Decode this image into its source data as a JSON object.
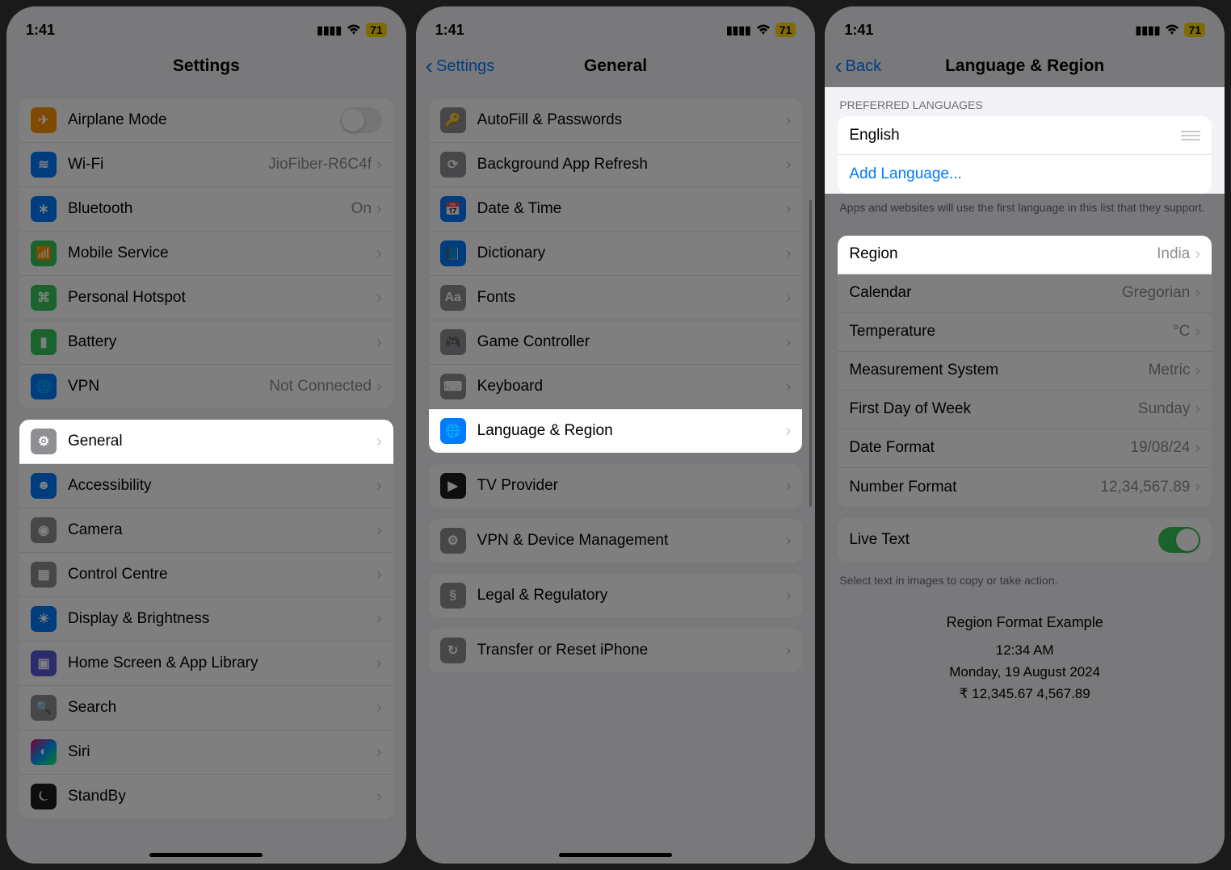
{
  "status": {
    "time": "1:41",
    "battery": "71"
  },
  "phone1": {
    "title": "Settings",
    "group1": [
      {
        "icon": "airplane",
        "label": "Airplane Mode",
        "toggle": false
      },
      {
        "icon": "wifi",
        "label": "Wi-Fi",
        "value": "JioFiber-R6C4f"
      },
      {
        "icon": "bluetooth",
        "label": "Bluetooth",
        "value": "On"
      },
      {
        "icon": "mobile",
        "label": "Mobile Service",
        "value": ""
      },
      {
        "icon": "hotspot",
        "label": "Personal Hotspot",
        "value": ""
      },
      {
        "icon": "battery",
        "label": "Battery",
        "value": ""
      },
      {
        "icon": "vpn",
        "label": "VPN",
        "value": "Not Connected"
      }
    ],
    "group2": [
      {
        "icon": "general",
        "label": "General"
      },
      {
        "icon": "accessibility",
        "label": "Accessibility"
      },
      {
        "icon": "camera",
        "label": "Camera"
      },
      {
        "icon": "control",
        "label": "Control Centre"
      },
      {
        "icon": "display",
        "label": "Display & Brightness"
      },
      {
        "icon": "home",
        "label": "Home Screen & App Library"
      },
      {
        "icon": "search",
        "label": "Search"
      },
      {
        "icon": "siri",
        "label": "Siri"
      },
      {
        "icon": "standby",
        "label": "StandBy"
      }
    ]
  },
  "phone2": {
    "back": "Settings",
    "title": "General",
    "group1": [
      {
        "icon": "autofill",
        "label": "AutoFill & Passwords"
      },
      {
        "icon": "refresh",
        "label": "Background App Refresh"
      },
      {
        "icon": "date",
        "label": "Date & Time"
      },
      {
        "icon": "dictionary",
        "label": "Dictionary"
      },
      {
        "icon": "fonts",
        "label": "Fonts"
      },
      {
        "icon": "game",
        "label": "Game Controller"
      },
      {
        "icon": "keyboard",
        "label": "Keyboard"
      },
      {
        "icon": "language",
        "label": "Language & Region"
      }
    ],
    "group2": [
      {
        "icon": "tv",
        "label": "TV Provider"
      }
    ],
    "group3": [
      {
        "icon": "vpnmgmt",
        "label": "VPN & Device Management"
      }
    ],
    "group4": [
      {
        "icon": "legal",
        "label": "Legal & Regulatory"
      }
    ],
    "group5": [
      {
        "icon": "transfer",
        "label": "Transfer or Reset iPhone"
      }
    ]
  },
  "phone3": {
    "back": "Back",
    "title": "Language & Region",
    "pref_header": "PREFERRED LANGUAGES",
    "language": "English",
    "add_language": "Add Language...",
    "pref_footer": "Apps and websites will use the first language in this list that they support.",
    "region_row": {
      "label": "Region",
      "value": "India"
    },
    "rows": [
      {
        "label": "Calendar",
        "value": "Gregorian"
      },
      {
        "label": "Temperature",
        "value": "°C"
      },
      {
        "label": "Measurement System",
        "value": "Metric"
      },
      {
        "label": "First Day of Week",
        "value": "Sunday"
      },
      {
        "label": "Date Format",
        "value": "19/08/24"
      },
      {
        "label": "Number Format",
        "value": "12,34,567.89"
      }
    ],
    "live_text": "Live Text",
    "live_text_footer": "Select text in images to copy or take action.",
    "example": {
      "title": "Region Format Example",
      "time": "12:34 AM",
      "date": "Monday, 19 August 2024",
      "numbers": "₹ 12,345.67   4,567.89"
    }
  },
  "iconColors": {
    "airplane": "#ff9500",
    "wifi": "#007aff",
    "bluetooth": "#007aff",
    "mobile": "#34c759",
    "hotspot": "#34c759",
    "battery": "#34c759",
    "vpn": "#007aff",
    "general": "#8e8e93",
    "accessibility": "#007aff",
    "camera": "#8e8e93",
    "control": "#8e8e93",
    "display": "#007aff",
    "home": "#5856d6",
    "search": "#8e8e93",
    "siri": "#1c1c1e",
    "standby": "#1c1c1e",
    "autofill": "#8e8e93",
    "refresh": "#8e8e93",
    "date": "#007aff",
    "dictionary": "#007aff",
    "fonts": "#8e8e93",
    "game": "#8e8e93",
    "keyboard": "#8e8e93",
    "language": "#007aff",
    "tv": "#1c1c1e",
    "vpnmgmt": "#8e8e93",
    "legal": "#8e8e93",
    "transfer": "#8e8e93"
  }
}
